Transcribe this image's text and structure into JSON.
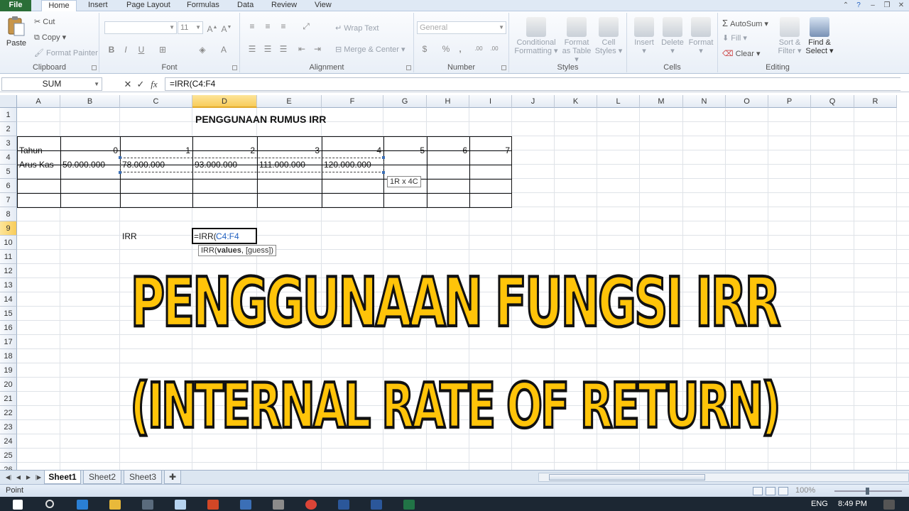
{
  "menu": {
    "tabs": [
      "File",
      "Home",
      "Insert",
      "Page Layout",
      "Formulas",
      "Data",
      "Review",
      "View"
    ],
    "active": "Home"
  },
  "ribbon": {
    "clipboard": {
      "label": "Clipboard",
      "paste": "Paste",
      "cut": "Cut",
      "copy": "Copy",
      "format_painter": "Format Painter"
    },
    "font": {
      "label": "Font",
      "size": "11",
      "bold": "B",
      "italic": "I",
      "underline": "U",
      "font_color": "A"
    },
    "alignment": {
      "label": "Alignment",
      "wrap": "Wrap Text",
      "merge": "Merge & Center"
    },
    "number": {
      "label": "Number",
      "format": "General",
      "currency": "$",
      "percent": "%",
      "comma": ",",
      "inc_dec": ".00",
      "dec_dec": ".00"
    },
    "styles": {
      "label": "Styles",
      "conditional": "Conditional",
      "conditional2": "Formatting",
      "format_as": "Format",
      "format_as2": "as Table",
      "cell_styles": "Cell",
      "cell_styles2": "Styles"
    },
    "cells": {
      "label": "Cells",
      "insert": "Insert",
      "delete": "Delete",
      "format": "Format"
    },
    "editing": {
      "label": "Editing",
      "autosum": "AutoSum",
      "fill": "Fill",
      "clear": "Clear",
      "sort": "Sort &",
      "sort2": "Filter",
      "find": "Find &",
      "find2": "Select"
    }
  },
  "formula_bar": {
    "name_box": "SUM",
    "cancel": "✕",
    "enter": "✓",
    "fx": "fx",
    "formula": "=IRR(C4:F4"
  },
  "grid": {
    "columns": [
      "A",
      "B",
      "C",
      "D",
      "E",
      "F",
      "G",
      "H",
      "I",
      "J",
      "K",
      "L",
      "M",
      "N",
      "O",
      "P",
      "Q",
      "R"
    ],
    "rows": [
      "1",
      "2",
      "3",
      "4",
      "5",
      "6",
      "7",
      "8",
      "9",
      "10",
      "11",
      "12",
      "13",
      "14",
      "15",
      "16",
      "17",
      "18",
      "19",
      "20",
      "21",
      "22",
      "23",
      "24",
      "25",
      "26"
    ],
    "selected_column": "D",
    "selected_row": "9"
  },
  "cells": {
    "title": "PENGGUNAAN RUMUS IRR",
    "tahun_label": "Tahun",
    "years": [
      "0",
      "1",
      "2",
      "3",
      "4",
      "5",
      "6",
      "7"
    ],
    "arus_label": "Arus Kas",
    "cashflows": [
      "50.000.000",
      "78.000.000",
      "93.000.000",
      "111.000.000",
      "120.000.000"
    ],
    "irr_label": "IRR",
    "editing_prefix": "=IRR(",
    "editing_ref": "C4:F4"
  },
  "tooltips": {
    "range_size": "1R x 4C",
    "fn_name": "IRR(",
    "fn_arg1": "values",
    "fn_rest": ", [guess])"
  },
  "overlay": {
    "line1": "PENGGUNAAN FUNGSI IRR",
    "line2": "(INTERNAL RATE OF RETURN)"
  },
  "sheets": {
    "tabs": [
      "Sheet1",
      "Sheet2",
      "Sheet3"
    ],
    "active": "Sheet1"
  },
  "status": {
    "mode": "Point",
    "zoom": "100%"
  },
  "taskbar": {
    "time": "8:49 PM",
    "lang": "ENG"
  },
  "colors": {
    "excel_green": "#2a6e37",
    "overlay_yellow": "#ffc409",
    "selected_header": "#f8cc5a",
    "ref_blue": "#1f5fbf"
  }
}
